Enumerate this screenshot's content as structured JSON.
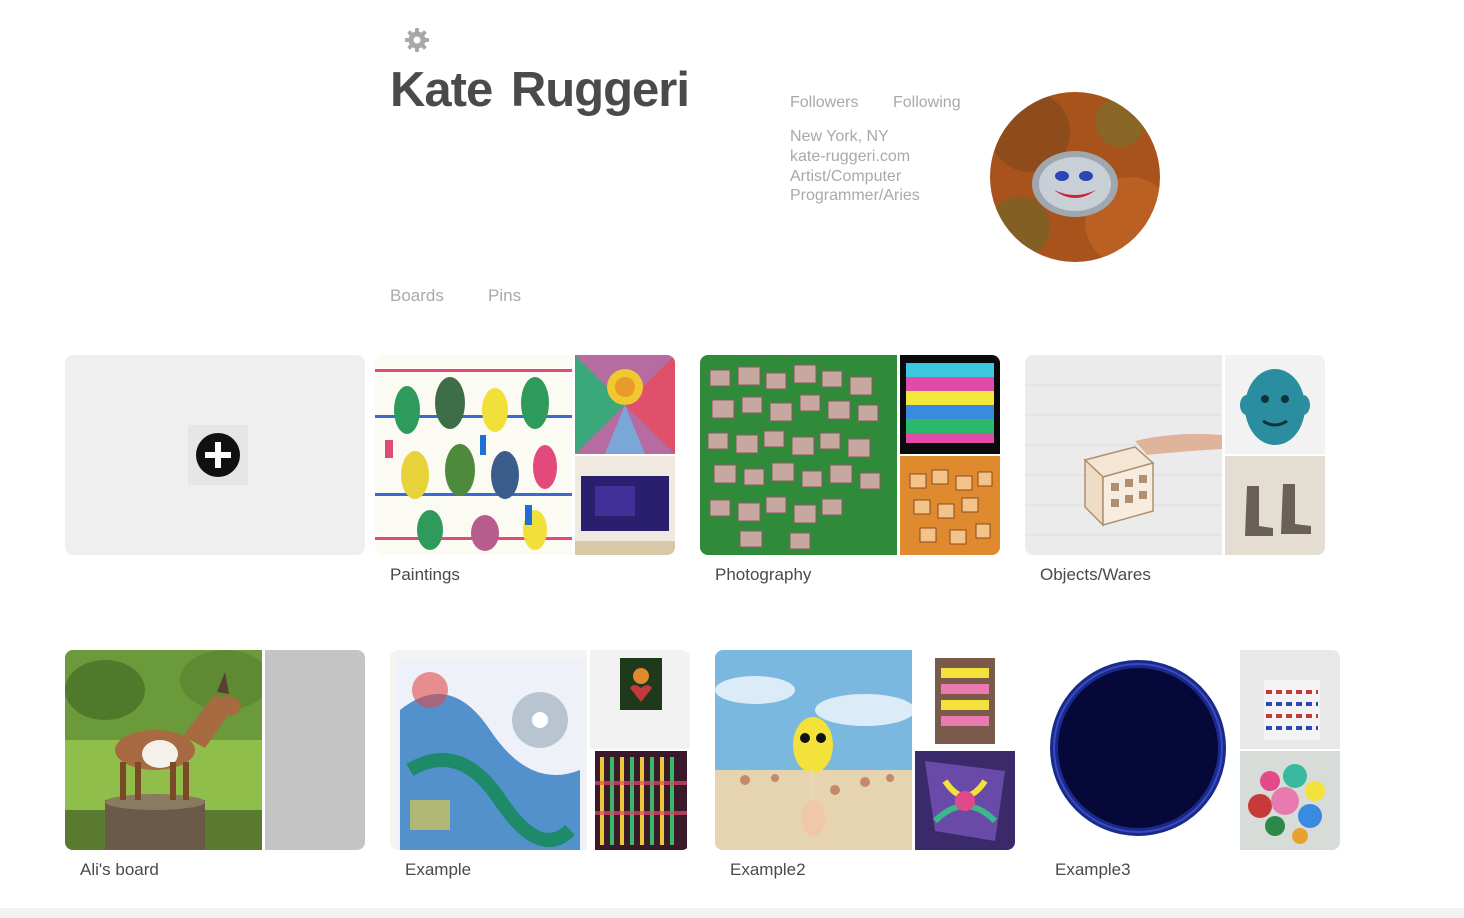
{
  "profile": {
    "name": "Kate Ruggeri",
    "followers_label": "Followers",
    "following_label": "Following",
    "location": "New York, NY",
    "website": "kate-ruggeri.com",
    "bio": "Artist/Computer Programmer/Aries",
    "settings_icon": "gear-icon",
    "avatar_icon": "avatar"
  },
  "tabs": [
    {
      "label": "Boards"
    },
    {
      "label": "Pins"
    }
  ],
  "create_board": {
    "icon": "plus-circle-icon"
  },
  "boards": [
    {
      "title": "Paintings"
    },
    {
      "title": "Photography"
    },
    {
      "title": "Objects/Wares"
    },
    {
      "title": "Ali's board"
    },
    {
      "title": "Example"
    },
    {
      "title": "Example2"
    },
    {
      "title": "Example3"
    }
  ],
  "colors": {
    "name_text": "#4a4a4a",
    "muted_text": "#a9a9a9",
    "create_board_bg": "#efefef",
    "placeholder_thumb": "#c4c4c4"
  }
}
